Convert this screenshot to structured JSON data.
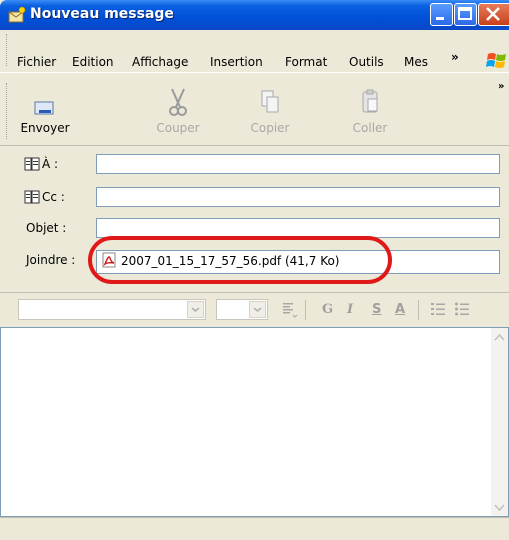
{
  "window": {
    "title": "Nouveau message"
  },
  "menu": {
    "items": [
      {
        "label": "Fichier"
      },
      {
        "label": "Edition"
      },
      {
        "label": "Affichage"
      },
      {
        "label": "Insertion"
      },
      {
        "label": "Format"
      },
      {
        "label": "Outils"
      },
      {
        "label": "Mes"
      }
    ],
    "overflow": "»"
  },
  "toolbar": {
    "buttons": [
      {
        "label": "Envoyer",
        "icon": "send-icon",
        "enabled": true
      },
      {
        "label": "Couper",
        "icon": "scissors-icon",
        "enabled": false
      },
      {
        "label": "Copier",
        "icon": "copy-icon",
        "enabled": false
      },
      {
        "label": "Coller",
        "icon": "paste-icon",
        "enabled": false
      }
    ],
    "overflow": "»"
  },
  "headers": {
    "to_label": "À :",
    "cc_label": "Cc :",
    "subject_label": "Objet :",
    "attach_label": "Joindre :",
    "to_value": "",
    "cc_value": "",
    "subject_value": "",
    "attachment": "2007_01_15_17_57_56.pdf (41,7 Ko)"
  },
  "format_toolbar": {
    "bold": "G",
    "italic": "I",
    "underline": "S",
    "font_color": "A"
  },
  "colors": {
    "titlebar": "#0a5fe0",
    "highlight": "#e01818",
    "window_bg": "#ece9d8"
  }
}
